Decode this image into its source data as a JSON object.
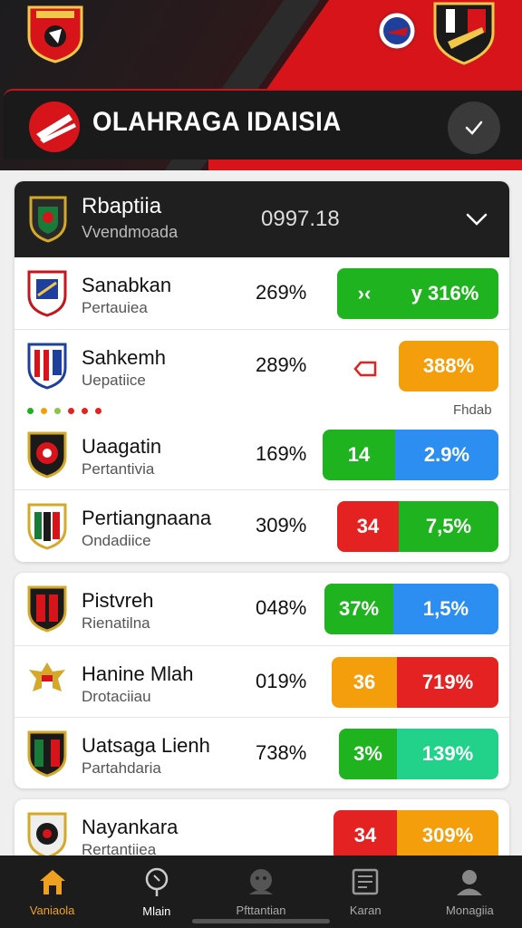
{
  "header": {
    "app_title": "OLAHRAGA IDAISIA",
    "left_crest_text": "",
    "colors": {
      "brand_red": "#d8141b",
      "dark": "#1a1a1a"
    }
  },
  "groups": [
    {
      "title": "Rbaptiia",
      "subtitle": "Vvendmoada",
      "value": "0997.18"
    }
  ],
  "rows": [
    {
      "name": "Sanabkan",
      "sub": "Pertauiea",
      "pct": "269%",
      "seg1": "›‹",
      "seg2": "у 316%",
      "seg1_color": "#22b022",
      "seg2_color": "#22b022"
    },
    {
      "name": "Sahkemh",
      "sub": "Uepatiice",
      "pct": "289%",
      "seg1": "",
      "seg2": "388%",
      "seg2_color": "#f59e0b"
    },
    {
      "name": "Uaagatin",
      "sub": "Pertantivia",
      "pct": "169%",
      "seg1": "14",
      "seg2": "2.9%",
      "seg1_color": "#1fb31f",
      "seg2_color": "#2b8ef0"
    },
    {
      "name": "Pertiangnaana",
      "sub": "Ondadiice",
      "pct": "309%",
      "seg1": "34",
      "seg2": "7,5%",
      "seg1_color": "#e52222",
      "seg2_color": "#22b022"
    },
    {
      "name": "Pistvreh",
      "sub": "Rienatilna",
      "pct": "048%",
      "seg1": "37%",
      "seg2": "1,5%",
      "seg1_color": "#1fb31f",
      "seg2_color": "#2b8ef0"
    },
    {
      "name": "Hanine Mlah",
      "sub": "Drotaciiau",
      "pct": "019%",
      "seg1": "36",
      "seg2": "719%",
      "seg1_color": "#f59e0b",
      "seg2_color": "#e52222"
    },
    {
      "name": "Uatsaga Lienh",
      "sub": "Partahdaria",
      "pct": "738%",
      "seg1": "3%",
      "seg2": "139%",
      "seg1_color": "#1fb31f",
      "seg2_color": "#22d18a"
    },
    {
      "name": "Nayankara",
      "sub": "Rertantiiea",
      "pct": "",
      "seg1": "34",
      "seg2": "309%",
      "seg1_color": "#e52222",
      "seg2_color": "#f59e0b"
    }
  ],
  "side_label": "Fhdab",
  "nav": [
    {
      "label": "Vaniaola",
      "icon": "home-icon"
    },
    {
      "label": "Mlain",
      "icon": "location-icon"
    },
    {
      "label": "Pfttantian",
      "icon": "person-icon"
    },
    {
      "label": "Karan",
      "icon": "news-icon"
    },
    {
      "label": "Monagiia",
      "icon": "profile-icon"
    }
  ]
}
